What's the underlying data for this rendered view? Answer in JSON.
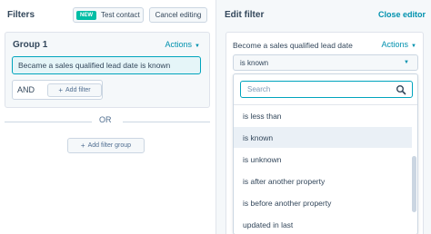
{
  "left": {
    "title": "Filters",
    "new_badge": "NEW",
    "test_contact_label": "Test contact",
    "cancel_editing_label": "Cancel editing",
    "group": {
      "title": "Group 1",
      "actions_label": "Actions",
      "filter": {
        "property": "Became a sales qualified lead date",
        "operator": "is known"
      },
      "and_label": "AND",
      "add_filter_label": "Add filter"
    },
    "or_label": "OR",
    "add_filter_group_label": "Add filter group"
  },
  "right": {
    "title": "Edit filter",
    "close_label": "Close editor",
    "card": {
      "property_label": "Become a sales qualified lead date",
      "actions_label": "Actions",
      "selected_value": "is known",
      "search_placeholder": "Search",
      "options": [
        "is less than",
        "is known",
        "is unknown",
        "is after another property",
        "is before another property",
        "updated in last"
      ],
      "selected_index": 1
    }
  },
  "colors": {
    "accent": "#0091ae",
    "teal_border": "#00a4bd",
    "badge": "#00bda5",
    "text": "#33475b"
  },
  "icons": [
    "plus-icon",
    "caret-down-icon",
    "search-icon"
  ]
}
